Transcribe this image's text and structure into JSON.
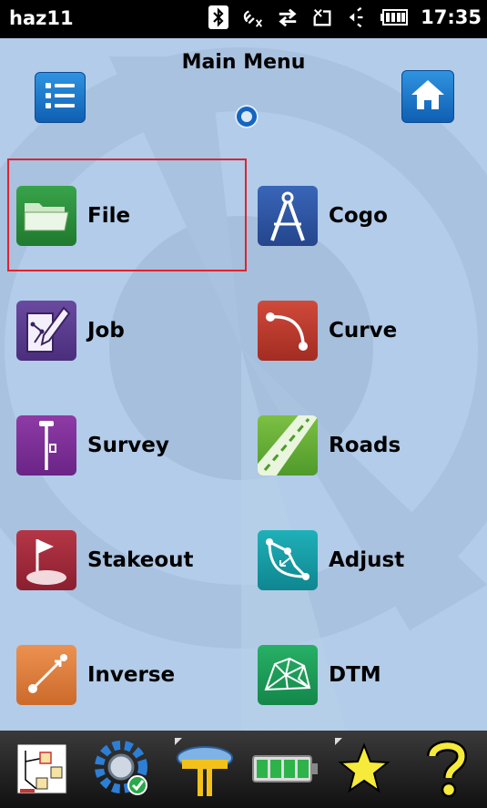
{
  "status_bar": {
    "title": "haz11",
    "time": "17:35",
    "icons": [
      "bluetooth-icon",
      "gps-off-icon",
      "sync-icon",
      "connection-icon",
      "speaker-icon",
      "battery-icon"
    ]
  },
  "main": {
    "heading": "Main Menu",
    "top_left_button": "list-menu-icon",
    "top_right_button": "home-icon",
    "selected_item": "File",
    "items": [
      {
        "label": "File",
        "icon": "folder-icon",
        "color": "#2e8b3a"
      },
      {
        "label": "Cogo",
        "icon": "compass-icon",
        "color": "#2f55a4"
      },
      {
        "label": "Job",
        "icon": "job-edit-icon",
        "color": "#5a3a8a"
      },
      {
        "label": "Curve",
        "icon": "curve-icon",
        "color": "#c0392b"
      },
      {
        "label": "Survey",
        "icon": "survey-pole-icon",
        "color": "#7b2f8f"
      },
      {
        "label": "Roads",
        "icon": "road-icon",
        "color": "#6cb23b"
      },
      {
        "label": "Stakeout",
        "icon": "stake-flag-icon",
        "color": "#a0283a"
      },
      {
        "label": "Adjust",
        "icon": "adjust-icon",
        "color": "#16a0a8"
      },
      {
        "label": "Inverse",
        "icon": "inverse-icon",
        "color": "#e07b39"
      },
      {
        "label": "DTM",
        "icon": "dtm-mesh-icon",
        "color": "#1f9e5a"
      }
    ]
  },
  "toolbar": {
    "items": [
      "map-view-icon",
      "settings-gear-icon",
      "gnss-receiver-icon",
      "battery-status-icon",
      "favorites-star-icon",
      "help-icon"
    ]
  }
}
